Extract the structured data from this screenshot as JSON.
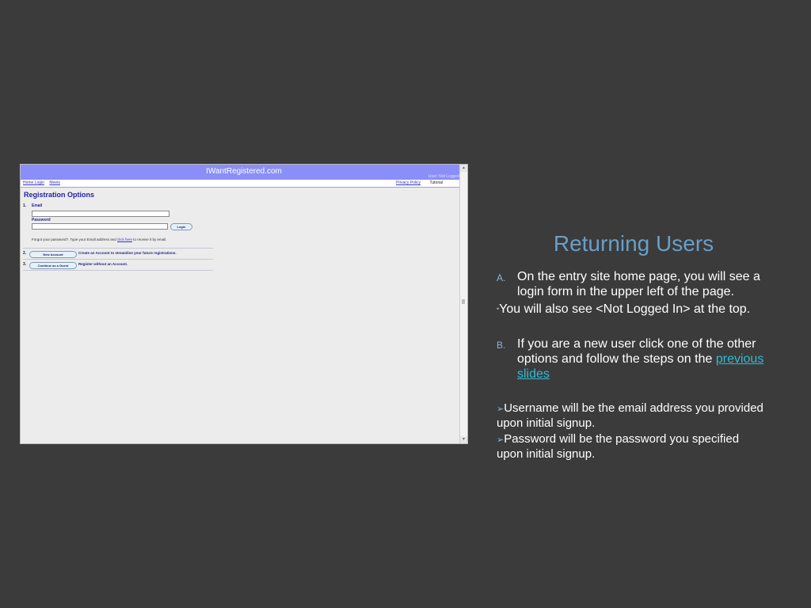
{
  "screenshot": {
    "site_title": "IWantRegistered.com",
    "user_status": "User: Not Logged",
    "nav_left": [
      "Home Login",
      "Meets"
    ],
    "nav_right": {
      "privacy": "Privacy Policy",
      "tutorial": "Tutorial"
    },
    "section_title": "Registration Options",
    "option1": {
      "number": "1.",
      "email_label": "Email",
      "password_label": "Password",
      "login_button": "Login",
      "forgot_text": "Forgot your password?.  Type your Email address and",
      "forgot_link": "click here",
      "forgot_after": "to receive it by email."
    },
    "option2": {
      "number": "2.",
      "button": "New Account",
      "description": "Create an Account to streamline your future registrations."
    },
    "option3": {
      "number": "3.",
      "button": "Continue as a Guest",
      "description": "Register without an Account."
    }
  },
  "slide": {
    "title": "Returning Users",
    "point_a_marker": "A.",
    "point_a": "On the entry site home page, you will see a login form in the upper left of the page.",
    "point_a_sub": "You will also see <Not Logged In> at the top.",
    "point_b_marker": "B.",
    "point_b_text": "If you are a new user click one of the other options and follow the steps on the",
    "point_b_link": "previous slides",
    "sub_bullet_1": "Username will be the email address you provided upon initial signup.",
    "sub_bullet_2": "Password will be the  password you specified upon initial signup."
  },
  "colors": {
    "background": "#3b3b3b",
    "title_accent": "#6a9fc7",
    "link": "#2fbbd2",
    "site_header": "#8a8ef8"
  }
}
